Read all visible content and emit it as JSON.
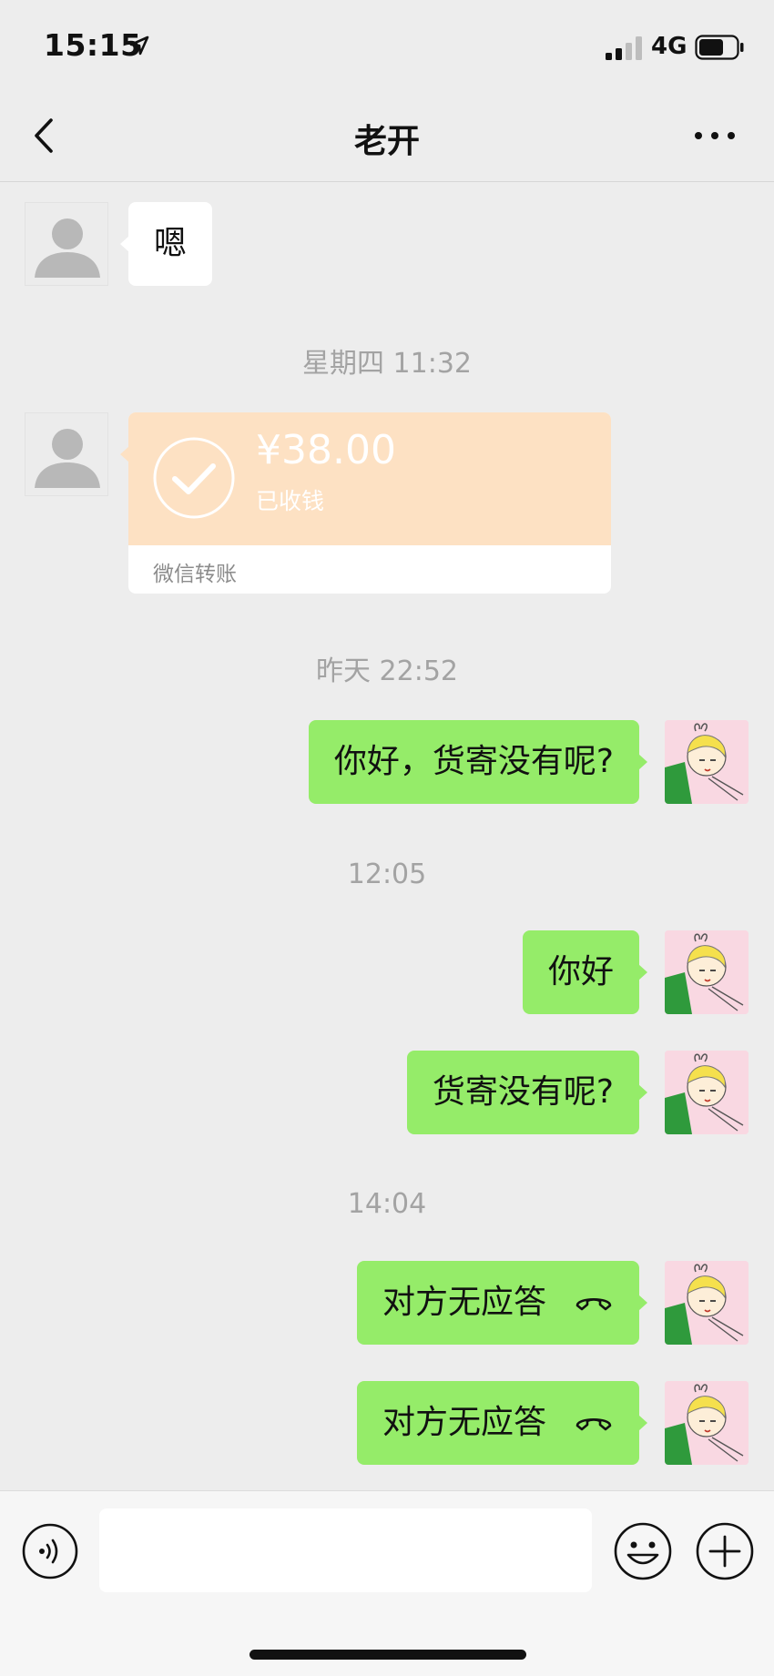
{
  "status_bar": {
    "time": "15:15",
    "network": "4G"
  },
  "header": {
    "title": "老开"
  },
  "messages": {
    "m1": {
      "text": "嗯"
    },
    "ts1": "星期四 11:32",
    "transfer": {
      "amount": "¥38.00",
      "status": "已收钱",
      "label": "微信转账"
    },
    "ts2": "昨天 22:52",
    "m2": {
      "text": "你好，货寄没有呢?"
    },
    "ts3": "12:05",
    "m3": {
      "text": "你好"
    },
    "m4": {
      "text": "货寄没有呢?"
    },
    "ts4": "14:04",
    "m5": {
      "text": "对方无应答"
    },
    "m6": {
      "text": "对方无应答"
    }
  },
  "input_bar": {
    "placeholder": ""
  },
  "icons": {
    "back": "chevron-left-icon",
    "more": "more-dots-icon",
    "voice": "voice-icon",
    "emoji": "emoji-icon",
    "plus": "plus-icon",
    "call": "phone-hangup-icon",
    "check": "check-circle-icon"
  },
  "colors": {
    "out_bubble": "#95ec69",
    "in_bubble": "#ffffff",
    "transfer": "#fde1c3",
    "background": "#ededed"
  }
}
